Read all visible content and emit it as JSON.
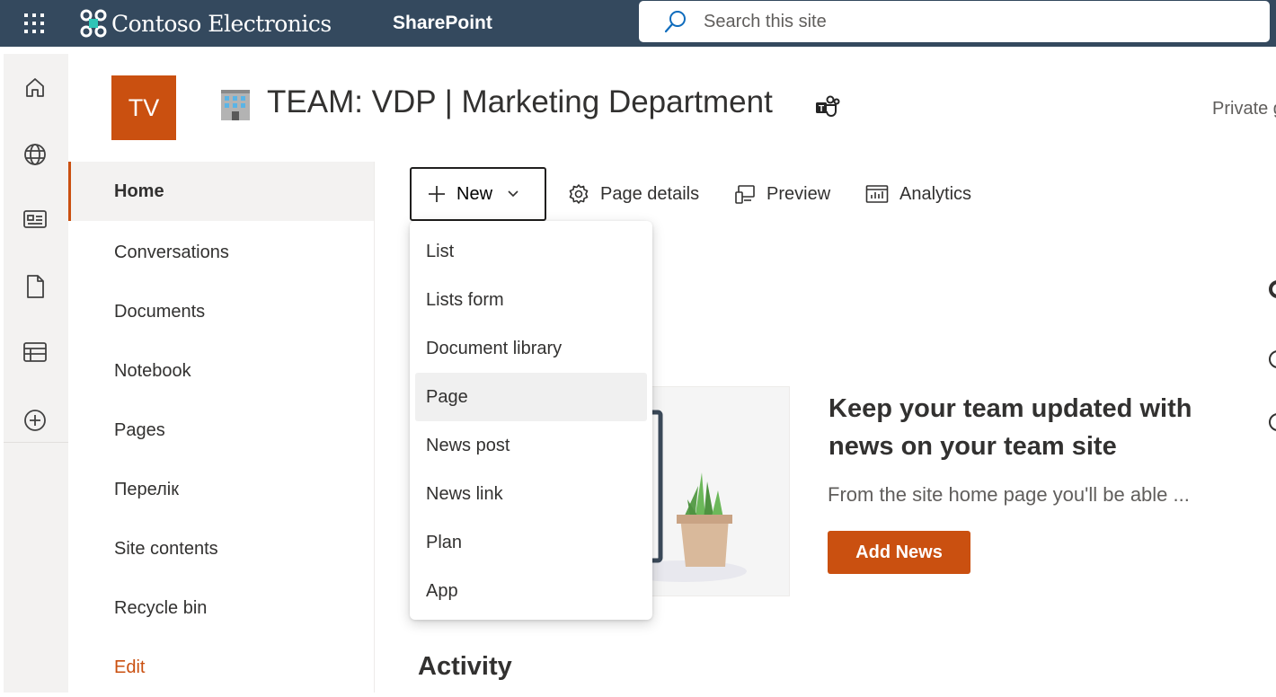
{
  "suite_bar": {
    "brand_name": "Contoso Electronics",
    "app_name": "SharePoint",
    "search": {
      "placeholder": "Search this site"
    },
    "colors": {
      "background": "#34495e"
    }
  },
  "app_bar": {
    "items": [
      {
        "name": "home-icon"
      },
      {
        "name": "globe-icon"
      },
      {
        "name": "news-icon"
      },
      {
        "name": "document-icon"
      },
      {
        "name": "list-icon"
      },
      {
        "name": "add-circle-icon"
      }
    ]
  },
  "site": {
    "logo_initials": "TV",
    "title": "TEAM: VDP | Marketing Department",
    "privacy": "Private g",
    "colors": {
      "accent": "#ca5010"
    }
  },
  "left_nav": {
    "items": [
      {
        "label": "Home",
        "selected": true
      },
      {
        "label": "Conversations"
      },
      {
        "label": "Documents"
      },
      {
        "label": "Notebook"
      },
      {
        "label": "Pages"
      },
      {
        "label": "Перелік"
      },
      {
        "label": "Site contents"
      },
      {
        "label": "Recycle bin"
      }
    ],
    "edit_label": "Edit"
  },
  "command_bar": {
    "new_label": "New",
    "page_details_label": "Page details",
    "preview_label": "Preview",
    "analytics_label": "Analytics"
  },
  "new_menu": {
    "items": [
      {
        "label": "List"
      },
      {
        "label": "Lists form"
      },
      {
        "label": "Document library"
      },
      {
        "label": "Page",
        "hovered": true
      },
      {
        "label": "News post"
      },
      {
        "label": "News link"
      },
      {
        "label": "Plan"
      },
      {
        "label": "App"
      }
    ]
  },
  "news": {
    "heading": "Keep your team updated with news on your team site",
    "description": "From the site home page you'll be able ...",
    "add_button": "Add News"
  },
  "activity": {
    "heading": "Activity"
  }
}
